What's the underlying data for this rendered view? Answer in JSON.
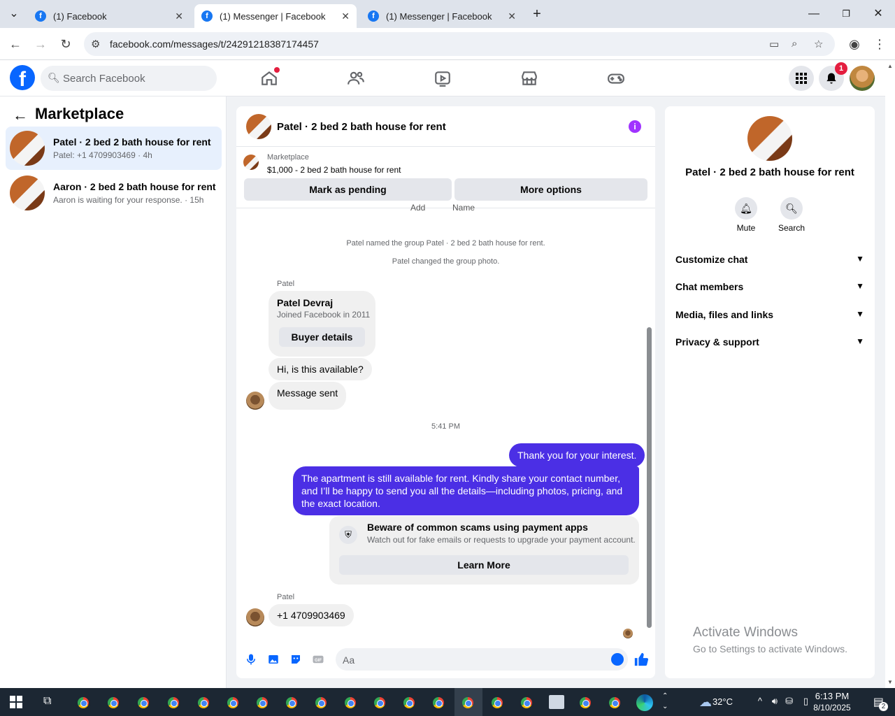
{
  "browser": {
    "tabs": [
      {
        "label": "(1) Facebook"
      },
      {
        "label": "(1) Messenger | Facebook"
      },
      {
        "label": "(1) Messenger | Facebook"
      }
    ],
    "url": "facebook.com/messages/t/24291218387174457"
  },
  "fb": {
    "search_placeholder": "Search Facebook",
    "notification_count": "1"
  },
  "sidebar": {
    "title": "Marketplace",
    "conversations": [
      {
        "name": "Patel · 2 bed 2 bath house for rent",
        "preview": "Patel: +1 4709903469 · 4h"
      },
      {
        "name": "Aaron · 2 bed 2 bath house for rent",
        "preview": "Aaron is waiting for your response. · 15h"
      }
    ]
  },
  "chat": {
    "title": "Patel · 2 bed 2 bath house for rent",
    "listing_source": "Marketplace",
    "listing_title": "$1,000 - 2 bed 2 bath house for rent",
    "mark_pending": "Mark as pending",
    "more_options": "More options",
    "clipped_labels": [
      "Add",
      "Name"
    ],
    "system_1": "Patel named the group Patel · 2 bed 2 bath house for rent.",
    "system_2": "Patel changed the group photo.",
    "sender_1": "Patel",
    "buyer_name": "Patel Devraj",
    "buyer_joined": "Joined Facebook in 2011",
    "buyer_details": "Buyer details",
    "msg_1": "Hi, is this available?",
    "msg_2": "Message sent",
    "time": "5:41 PM",
    "out_1": "Thank you for your interest.",
    "out_2": "The apartment is still available for rent. Kindly share your contact number, and I’ll be happy to send you all the details—including photos, pricing, and the exact location.",
    "scam_title": "Beware of common scams using payment apps",
    "scam_text": "Watch out for fake emails or requests to upgrade your payment account.",
    "learn_more": "Learn More",
    "sender_2": "Patel",
    "msg_3": "+1 4709903469",
    "composer_placeholder": "Aa"
  },
  "details": {
    "name": "Patel · 2 bed 2 bath house for rent",
    "mute": "Mute",
    "search": "Search",
    "sections": [
      "Customize chat",
      "Chat members",
      "Media, files and links",
      "Privacy & support"
    ],
    "activate_title": "Activate Windows",
    "activate_sub": "Go to Settings to activate Windows."
  },
  "taskbar": {
    "weather": "32°C",
    "time": "6:13 PM",
    "date": "8/10/2025",
    "notif": "2"
  },
  "colors": {
    "brand": "#0866ff",
    "outgoing": "#4b2fe5",
    "selected": "#e7f0fd"
  }
}
